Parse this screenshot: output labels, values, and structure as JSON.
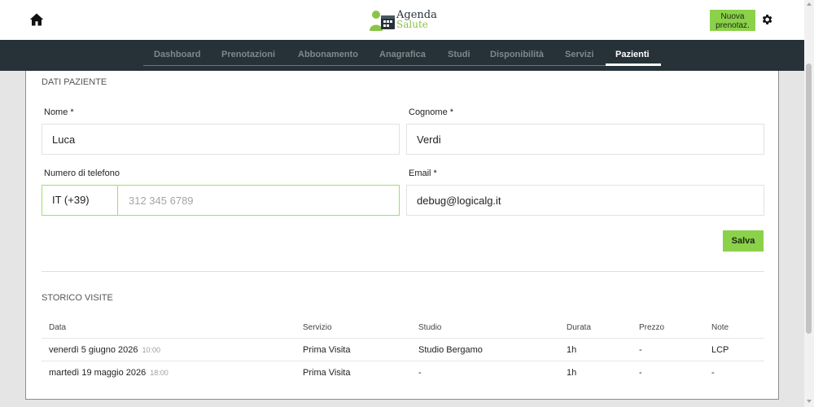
{
  "header": {
    "logo_line1": "Agenda",
    "logo_line2": "Salute",
    "new_booking_line1": "Nuova",
    "new_booking_line2": "prenotaz."
  },
  "nav": {
    "tabs": [
      {
        "label": "Dashboard"
      },
      {
        "label": "Prenotazioni"
      },
      {
        "label": "Abbonamento"
      },
      {
        "label": "Anagrafica"
      },
      {
        "label": "Studi"
      },
      {
        "label": "Disponibilità"
      },
      {
        "label": "Servizi"
      },
      {
        "label": "Pazienti"
      }
    ],
    "active": "Pazienti"
  },
  "patient": {
    "section_title": "DATI PAZIENTE",
    "first_name_label": "Nome *",
    "first_name_value": "Luca",
    "last_name_label": "Cognome *",
    "last_name_value": "Verdi",
    "phone_label": "Numero di telefono",
    "phone_prefix": "IT (+39)",
    "phone_placeholder": "312 345 6789",
    "email_label": "Email *",
    "email_value": "debug@logicalg.it",
    "save_label": "Salva"
  },
  "history": {
    "section_title": "STORICO VISITE",
    "columns": [
      "Data",
      "Servizio",
      "Studio",
      "Durata",
      "Prezzo",
      "Note"
    ],
    "rows": [
      {
        "date": "venerdì 5 giugno 2026",
        "time": "10:00",
        "service": "Prima Visita",
        "studio": "Studio Bergamo",
        "duration": "1h",
        "price": "-",
        "notes": "LCP"
      },
      {
        "date": "martedì 19 maggio 2026",
        "time": "18:00",
        "service": "Prima Visita",
        "studio": "-",
        "duration": "1h",
        "price": "-",
        "notes": "-"
      }
    ]
  },
  "colors": {
    "navbar": "#263238",
    "accent": "#8bd14a",
    "phone_border": "#9be26a"
  }
}
